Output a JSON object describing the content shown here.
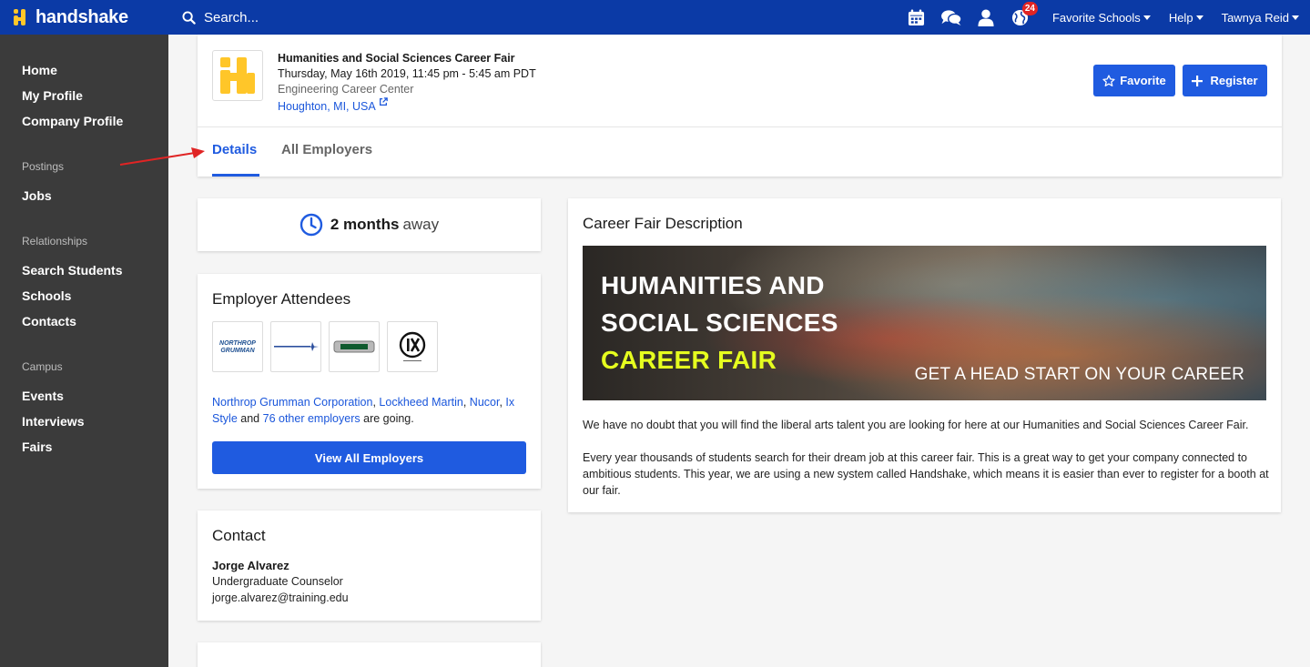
{
  "topbar": {
    "brand": "handshake",
    "search_placeholder": "Search...",
    "notifications_count": "24",
    "menus": [
      "Favorite Schools",
      "Help",
      "Tawnya Reid"
    ]
  },
  "sidebar": {
    "items_top": [
      "Home",
      "My Profile",
      "Company Profile"
    ],
    "sections": [
      {
        "title": "Postings",
        "items": [
          "Jobs"
        ]
      },
      {
        "title": "Relationships",
        "items": [
          "Search Students",
          "Schools",
          "Contacts"
        ]
      },
      {
        "title": "Campus",
        "items": [
          "Events",
          "Interviews",
          "Fairs"
        ]
      }
    ]
  },
  "fair": {
    "title": "Humanities and Social Sciences Career Fair",
    "datetime": "Thursday, May 16th 2019, 11:45 pm - 5:45 am PDT",
    "venue": "Engineering Career Center",
    "location": "Houghton, MI, USA",
    "favorite_label": "Favorite",
    "register_label": "Register"
  },
  "tabs": [
    "Details",
    "All Employers"
  ],
  "countdown": {
    "value": "2 months",
    "suffix": "away"
  },
  "attendees": {
    "heading": "Employer Attendees",
    "names": [
      "Northrop Grumman Corporation",
      "Lockheed Martin",
      "Nucor",
      "Ix Style"
    ],
    "others": "76 other employers",
    "and": "and",
    "going": "are going.",
    "button": "View All Employers"
  },
  "contact": {
    "heading": "Contact",
    "name": "Jorge Alvarez",
    "role": "Undergraduate Counselor",
    "email": "jorge.alvarez@training.edu"
  },
  "description": {
    "heading": "Career Fair Description",
    "banner_line1": "HUMANITIES AND",
    "banner_line2": "SOCIAL SCIENCES",
    "banner_line3": "CAREER FAIR",
    "banner_tagline": "GET A HEAD START ON YOUR CAREER",
    "p1": "We have no doubt that you will find the liberal arts talent you are looking for here at our Humanities and Social Sciences Career Fair.",
    "p2": "Every year thousands of students search for their dream job at this career fair. This is a great way to get your company connected to ambitious students. This year, we are using a new system called Handshake, which means it is easier than ever to register for a booth at our fair."
  },
  "colors": {
    "nav": "#0b3aa6",
    "accent": "#1f5be0",
    "sidebar": "#3b3b3b",
    "banner_highlight": "#e6ff1f"
  }
}
